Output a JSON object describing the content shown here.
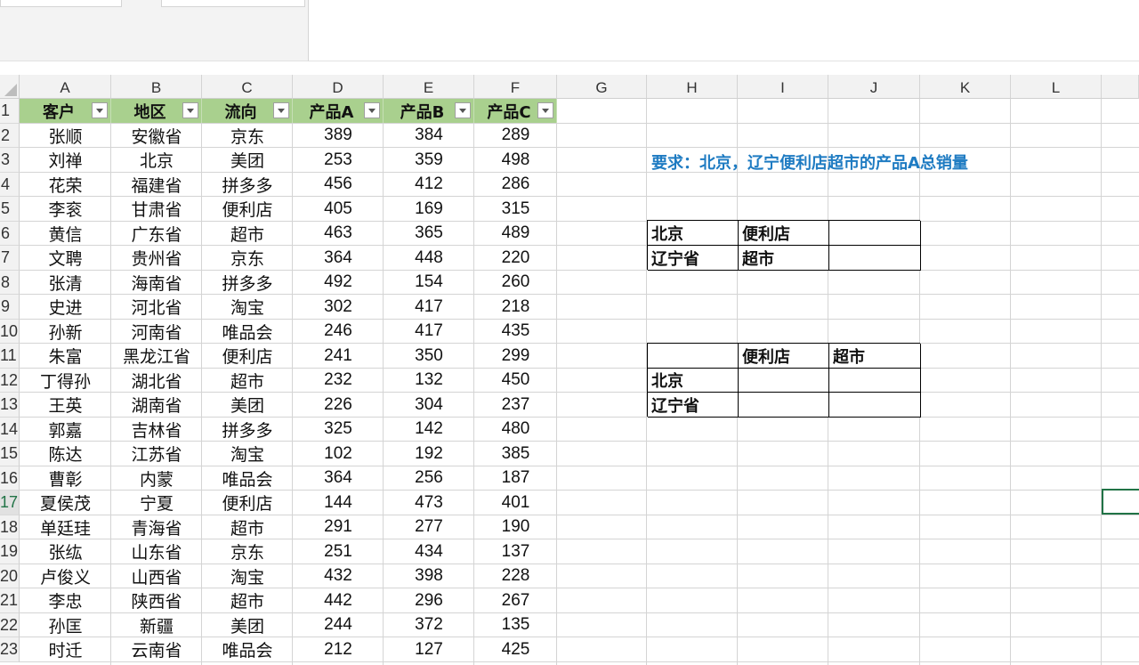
{
  "columns": [
    "A",
    "B",
    "C",
    "D",
    "E",
    "F",
    "G",
    "H",
    "I",
    "J",
    "K",
    "L"
  ],
  "row_numbers": [
    "1",
    "2",
    "3",
    "4",
    "5",
    "6",
    "7",
    "8",
    "9",
    "10",
    "11",
    "12",
    "13",
    "14",
    "15",
    "16",
    "17",
    "18",
    "19",
    "20",
    "21",
    "22",
    "23"
  ],
  "header": {
    "customer": "客户",
    "region": "地区",
    "channel": "流向",
    "product_a": "产品A",
    "product_b": "产品B",
    "product_c": "产品C"
  },
  "rows": [
    {
      "customer": "张顺",
      "region": "安徽省",
      "channel": "京东",
      "a": "389",
      "b": "384",
      "c": "289"
    },
    {
      "customer": "刘禅",
      "region": "北京",
      "channel": "美团",
      "a": "253",
      "b": "359",
      "c": "498"
    },
    {
      "customer": "花荣",
      "region": "福建省",
      "channel": "拼多多",
      "a": "456",
      "b": "412",
      "c": "286"
    },
    {
      "customer": "李衮",
      "region": "甘肃省",
      "channel": "便利店",
      "a": "405",
      "b": "169",
      "c": "315"
    },
    {
      "customer": "黄信",
      "region": "广东省",
      "channel": "超市",
      "a": "463",
      "b": "365",
      "c": "489"
    },
    {
      "customer": "文聘",
      "region": "贵州省",
      "channel": "京东",
      "a": "364",
      "b": "448",
      "c": "220"
    },
    {
      "customer": "张清",
      "region": "海南省",
      "channel": "拼多多",
      "a": "492",
      "b": "154",
      "c": "260"
    },
    {
      "customer": "史进",
      "region": "河北省",
      "channel": "淘宝",
      "a": "302",
      "b": "417",
      "c": "218"
    },
    {
      "customer": "孙新",
      "region": "河南省",
      "channel": "唯品会",
      "a": "246",
      "b": "417",
      "c": "435"
    },
    {
      "customer": "朱富",
      "region": "黑龙江省",
      "channel": "便利店",
      "a": "241",
      "b": "350",
      "c": "299"
    },
    {
      "customer": "丁得孙",
      "region": "湖北省",
      "channel": "超市",
      "a": "232",
      "b": "132",
      "c": "450"
    },
    {
      "customer": "王英",
      "region": "湖南省",
      "channel": "美团",
      "a": "226",
      "b": "304",
      "c": "237"
    },
    {
      "customer": "郭嘉",
      "region": "吉林省",
      "channel": "拼多多",
      "a": "325",
      "b": "142",
      "c": "480"
    },
    {
      "customer": "陈达",
      "region": "江苏省",
      "channel": "淘宝",
      "a": "102",
      "b": "192",
      "c": "385"
    },
    {
      "customer": "曹彰",
      "region": "内蒙",
      "channel": "唯品会",
      "a": "364",
      "b": "256",
      "c": "187"
    },
    {
      "customer": "夏侯茂",
      "region": "宁夏",
      "channel": "便利店",
      "a": "144",
      "b": "473",
      "c": "401"
    },
    {
      "customer": "单廷珪",
      "region": "青海省",
      "channel": "超市",
      "a": "291",
      "b": "277",
      "c": "190"
    },
    {
      "customer": "张纮",
      "region": "山东省",
      "channel": "京东",
      "a": "251",
      "b": "434",
      "c": "137"
    },
    {
      "customer": "卢俊义",
      "region": "山西省",
      "channel": "淘宝",
      "a": "432",
      "b": "398",
      "c": "228"
    },
    {
      "customer": "李忠",
      "region": "陕西省",
      "channel": "超市",
      "a": "442",
      "b": "296",
      "c": "267"
    },
    {
      "customer": "孙匡",
      "region": "新疆",
      "channel": "美团",
      "a": "244",
      "b": "372",
      "c": "135"
    },
    {
      "customer": "时迁",
      "region": "云南省",
      "channel": "唯品会",
      "a": "212",
      "b": "127",
      "c": "425"
    }
  ],
  "requirement": "要求：北京，辽宁便利店超市的产品A总销量",
  "criteria_table": [
    {
      "region": "北京",
      "channel": "便利店",
      "result": ""
    },
    {
      "region": "辽宁省",
      "channel": "超市",
      "result": ""
    }
  ],
  "cross_table": {
    "col_headers": [
      "便利店",
      "超市"
    ],
    "row_headers": [
      "北京",
      "辽宁省"
    ]
  },
  "colors": {
    "header_fill": "#a9d08e",
    "requirement_text": "#1e7bc2",
    "selection": "#217346"
  }
}
